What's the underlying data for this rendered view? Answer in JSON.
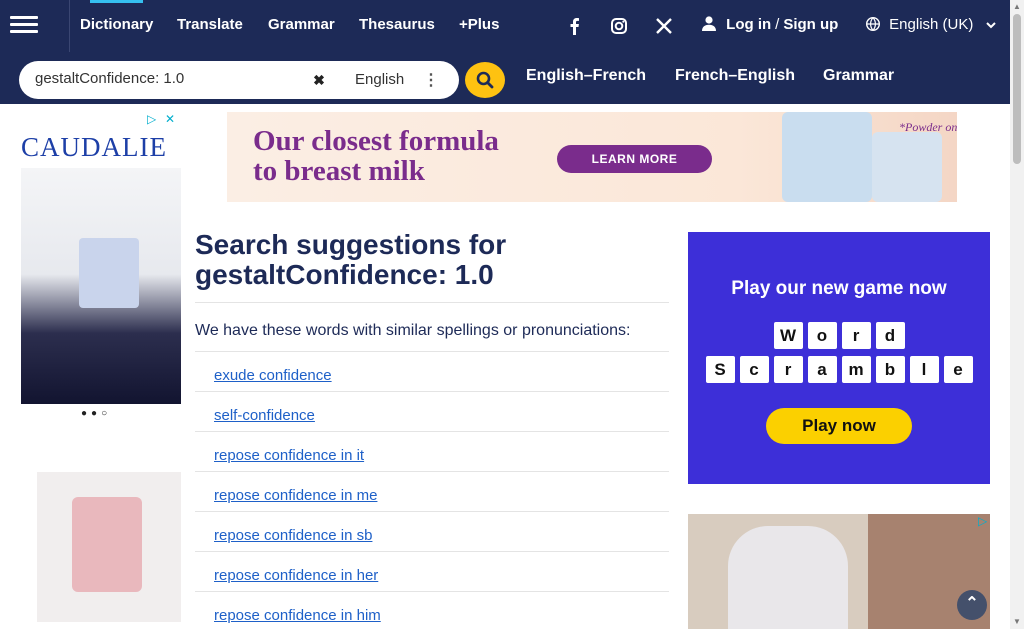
{
  "nav": {
    "links": [
      {
        "label": "Dictionary",
        "active": true
      },
      {
        "label": "Translate"
      },
      {
        "label": "Grammar"
      },
      {
        "label": "Thesaurus"
      },
      {
        "label": "+Plus"
      }
    ],
    "social_icons": [
      "facebook-icon",
      "instagram-icon",
      "x-twitter-icon"
    ],
    "login": "Log in",
    "slash": "/",
    "signup": "Sign up",
    "language": "English (UK)"
  },
  "search": {
    "query": "gestaltConfidence: 1.0",
    "dictionary": "English",
    "quick_links": [
      "English–French",
      "French–English",
      "Grammar"
    ]
  },
  "ads": {
    "left_brand": "CAUDALIE",
    "top_headline_1": "Our closest formula",
    "top_headline_2": "to breast milk",
    "top_button": "LEARN MORE",
    "top_note": "*Powder only",
    "right_title": "Play our new game now",
    "right_game_word_1": [
      "W",
      "o",
      "r",
      "d"
    ],
    "right_game_word_2": [
      "S",
      "c",
      "r",
      "a",
      "m",
      "b",
      "l",
      "e"
    ],
    "right_button": "Play now"
  },
  "main": {
    "heading_prefix": "Search suggestions for",
    "heading_query": "gestaltConfidence: 1.0",
    "intro": "We have these words with similar spellings or pronunciations:",
    "suggestions": [
      "exude confidence",
      "self-confidence",
      "repose confidence in it",
      "repose confidence in me",
      "repose confidence in sb",
      "repose confidence in her",
      "repose confidence in him"
    ]
  },
  "colors": {
    "nav_bg": "#1d2a57",
    "accent_yellow": "#fec211",
    "link_blue": "#1e60c8",
    "game_purple": "#3d2fd8"
  }
}
